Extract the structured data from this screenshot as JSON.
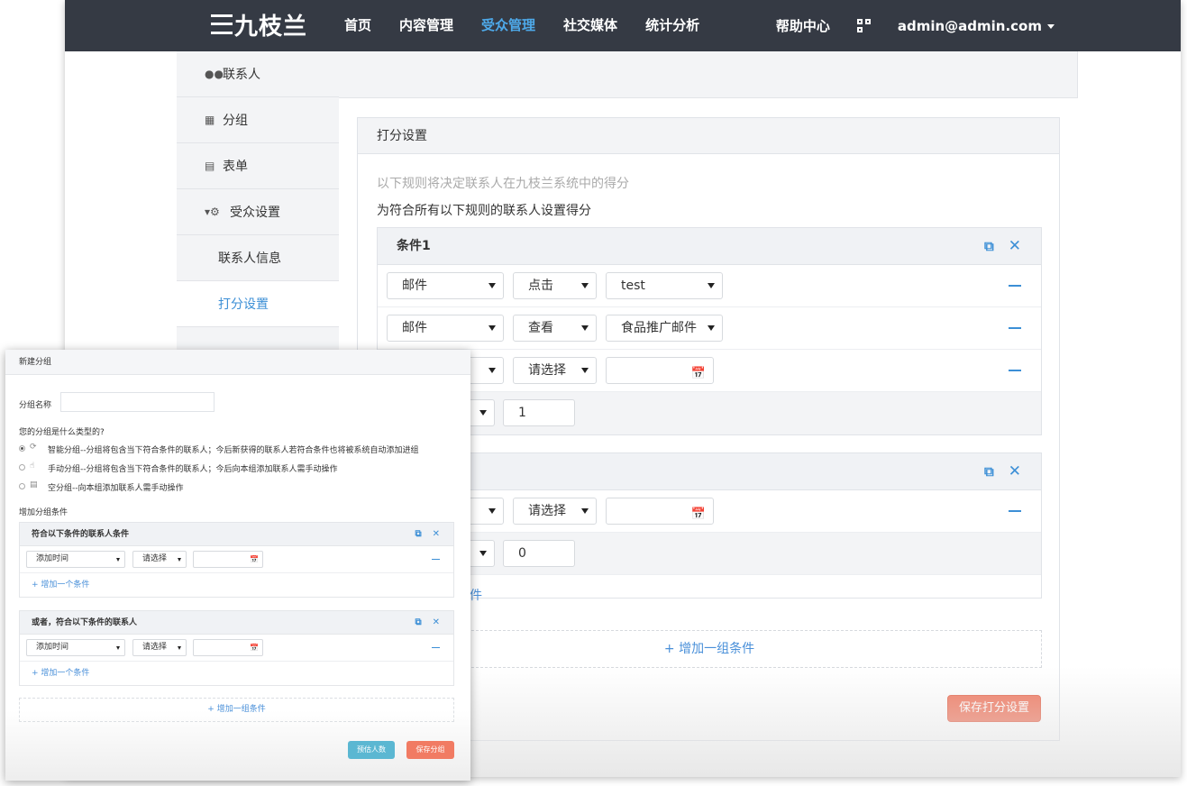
{
  "brand": {
    "name": "九枝兰"
  },
  "nav": [
    "首页",
    "内容管理",
    "受众管理",
    "社交媒体",
    "统计分析"
  ],
  "header": {
    "help": "帮助中心",
    "user": "admin@admin.com"
  },
  "sidebar": {
    "items": [
      "联系人",
      "分组",
      "表单",
      "受众设置"
    ],
    "sub_items": [
      "联系人信息",
      "打分设置"
    ]
  },
  "panel": {
    "title": "打分设置",
    "hint": "以下规则将决定联系人在九枝兰系统中的得分",
    "hint2": "为符合所有以下规则的联系人设置得分",
    "group1": {
      "title": "条件1",
      "rows": [
        {
          "field": "邮件",
          "op": "点击",
          "value": "test"
        },
        {
          "field": "邮件",
          "op": "查看",
          "value": "食品推广邮件"
        },
        {
          "op": "请选择"
        }
      ],
      "score": "1"
    },
    "group2": {
      "rows": [
        {
          "op": "请选择"
        }
      ],
      "score": "0",
      "add_condition_partial": "件"
    },
    "add_group": "+ 增加一组条件",
    "save": "保存打分设置"
  },
  "dialog": {
    "title": "新建分组",
    "name_label": "分组名称",
    "type_question": "您的分组是什么类型的?",
    "options": [
      "智能分组--分组将包含当下符合条件的联系人；今后新获得的联系人若符合条件也将被系统自动添加进组",
      "手动分组--分组将包含当下符合条件的联系人；今后向本组添加联系人需手动操作",
      "空分组--向本组添加联系人需手动操作"
    ],
    "conditions_label": "增加分组条件",
    "block1_title": "符合以下条件的联系人条件",
    "block2_title": "或者，符合以下条件的联系人",
    "row_field": "添加时间",
    "row_op": "请选择",
    "add_condition": "+ 增加一个条件",
    "add_group": "+ 增加一组条件",
    "estimate": "预估人数",
    "save": "保存分组"
  },
  "colors": {
    "topbar": "#353a44",
    "accent": "#3c8fd6",
    "save": "#f17b63",
    "estimate": "#5bb7d2"
  }
}
